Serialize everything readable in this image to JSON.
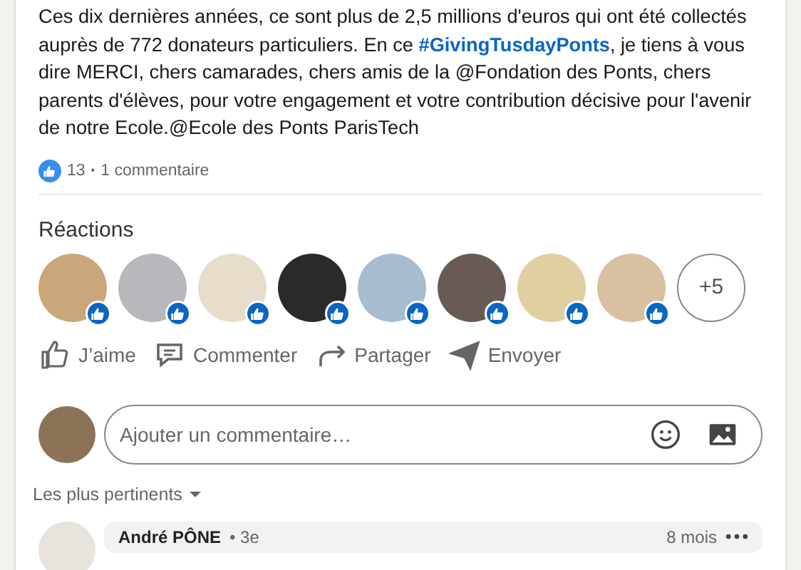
{
  "post": {
    "segments": [
      {
        "kind": "text",
        "text": "Ces dix dernières années, ce sont plus de 2,5 millions d'euros qui ont été collectés auprès de 772 donateurs particuliers. En ce "
      },
      {
        "kind": "hashtag",
        "text": "#GivingTusdayPonts"
      },
      {
        "kind": "text",
        "text": ", je tiens à vous dire MERCI, chers camarades, chers amis de la @Fondation des Ponts, chers parents d'élèves, pour votre engagement et votre contribution décisive pour l'avenir de notre Ecole.@Ecole des Ponts ParisTech"
      }
    ]
  },
  "social_counts": {
    "likes": "13",
    "separator": "•",
    "comments": "1 commentaire"
  },
  "reactions": {
    "title": "Réactions",
    "people": [
      {
        "color": "#c9a77a"
      },
      {
        "color": "#b8b8bc"
      },
      {
        "color": "#e8dccb"
      },
      {
        "color": "#2a2a2a"
      },
      {
        "color": "#a8bcd0"
      },
      {
        "color": "#6a5a55"
      },
      {
        "color": "#e0cfa0"
      },
      {
        "color": "#d8c0a0"
      }
    ],
    "more": "+5"
  },
  "actions": [
    {
      "kind": "like",
      "label": "J’aime"
    },
    {
      "kind": "comment",
      "label": "Commenter"
    },
    {
      "kind": "share",
      "label": "Partager"
    },
    {
      "kind": "send",
      "label": "Envoyer"
    }
  ],
  "comment_box": {
    "placeholder": "Ajouter un commentaire…"
  },
  "sort": {
    "label": "Les plus pertinents"
  },
  "comments": [
    {
      "author": "André PÔNE",
      "degree": "• 3e",
      "time": "8 mois"
    }
  ]
}
